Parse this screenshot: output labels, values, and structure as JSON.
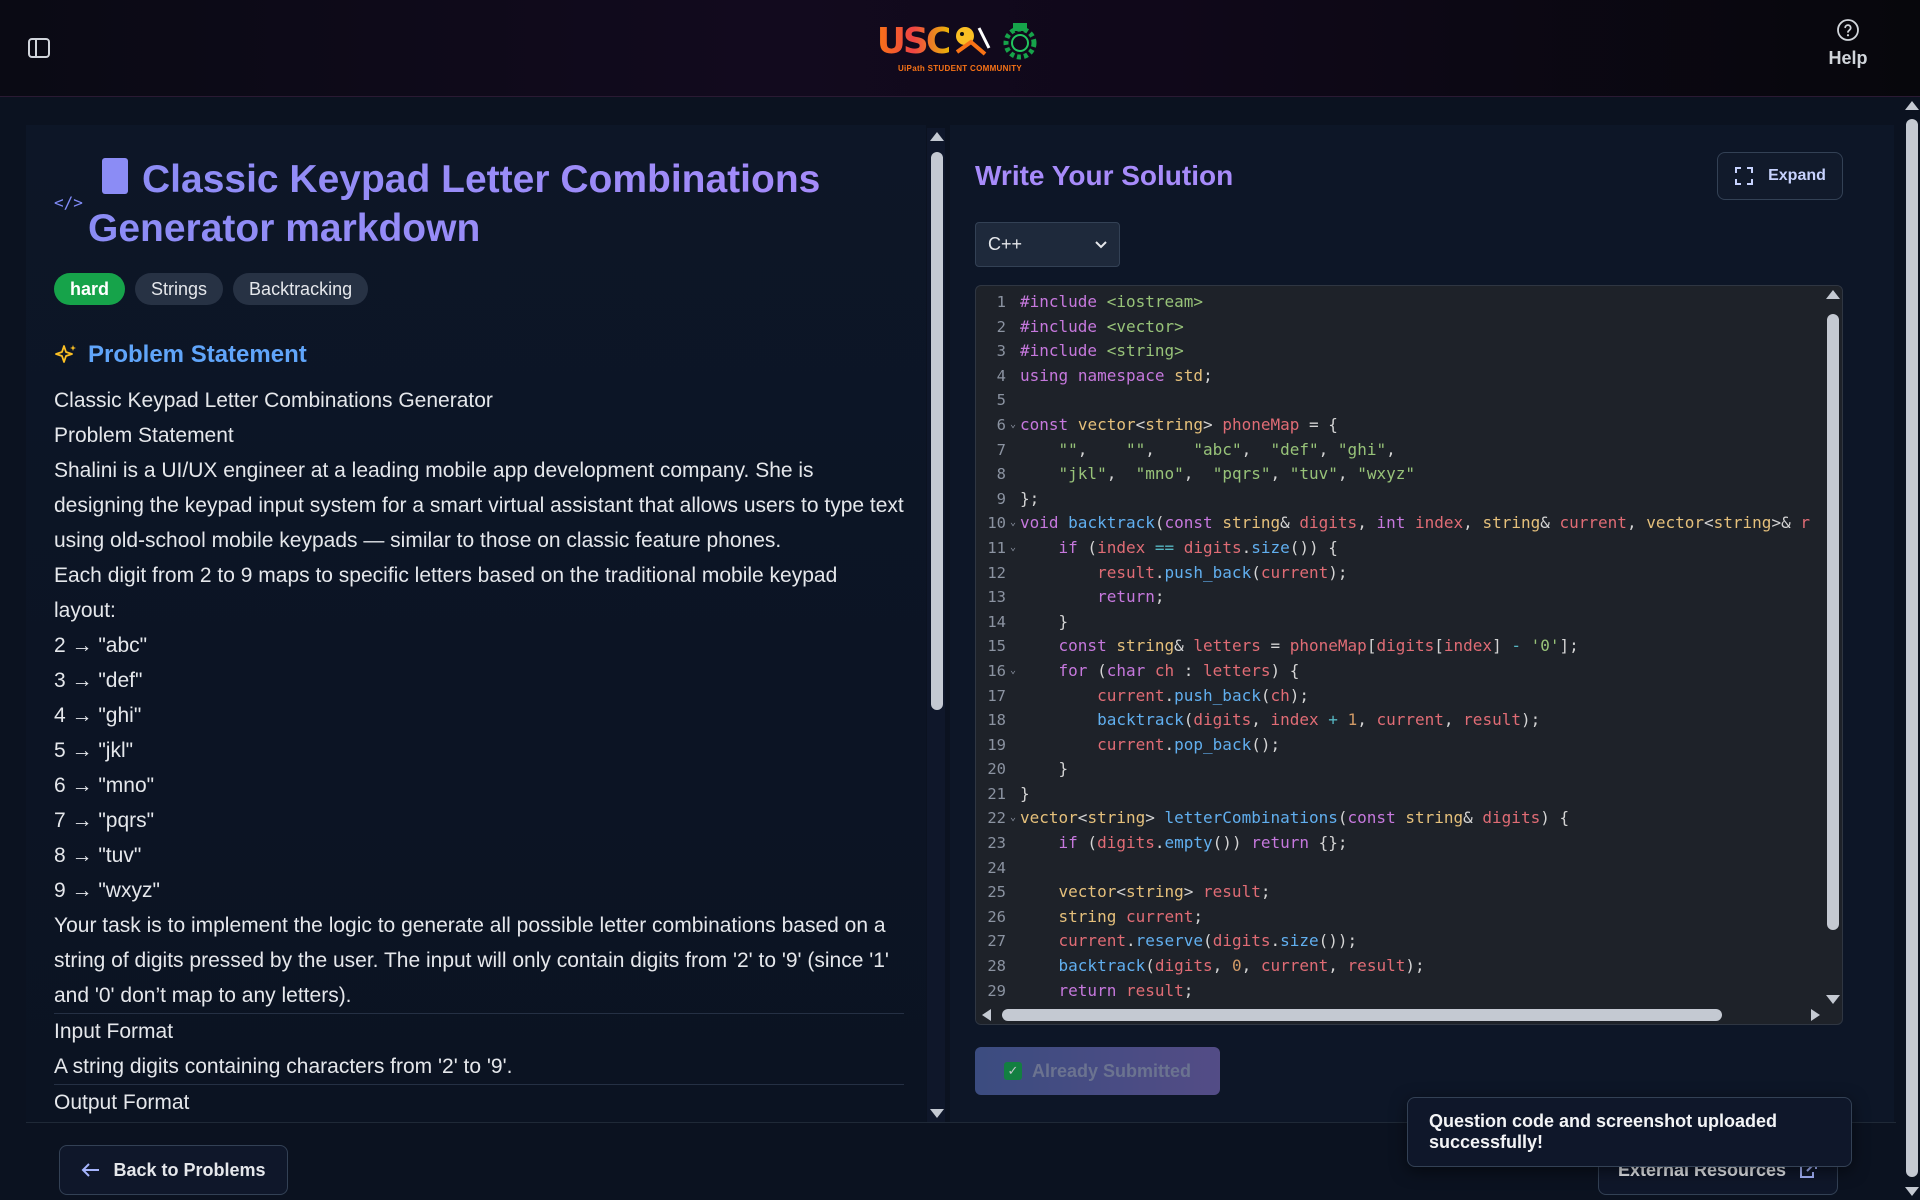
{
  "header": {
    "logo_text": "USC",
    "logo_subtitle": "UiPath STUDENT COMMUNITY",
    "help_label": "Help"
  },
  "problem": {
    "title": "Classic Keypad Letter Combinations Generator markdown",
    "tags": [
      "hard",
      "Strings",
      "Backtracking"
    ],
    "section_title": "Problem Statement",
    "statement": [
      "Classic Keypad Letter Combinations Generator",
      "Problem Statement",
      "Shalini is a UI/UX engineer at a leading mobile app development company. She is designing the keypad input system for a smart virtual assistant that allows users to type text using old-school mobile keypads — similar to those on classic feature phones.",
      "Each digit from 2 to 9 maps to specific letters based on the traditional mobile keypad layout:",
      "2 → \"abc\"",
      "3 → \"def\"",
      "4 → \"ghi\"",
      "5 → \"jkl\"",
      "6 → \"mno\"",
      "7 → \"pqrs\"",
      "8 → \"tuv\"",
      "9 → \"wxyz\"",
      "Your task is to implement the logic to generate all possible letter combinations based on a string of digits pressed by the user. The input will only contain digits from '2' to '9' (since '1' and '0' don’t map to any letters).",
      "Input Format",
      "A string digits containing characters from '2' to '9'.",
      "Output Format"
    ]
  },
  "editor": {
    "title": "Write Your Solution",
    "expand_label": "Expand",
    "language": "C++",
    "submit_label": "Already Submitted",
    "code_lines": [
      "#include <iostream>",
      "#include <vector>",
      "#include <string>",
      "using namespace std;",
      "",
      "const vector<string> phoneMap = {",
      "    \"\",    \"\",    \"abc\",  \"def\", \"ghi\",",
      "    \"jkl\",  \"mno\",  \"pqrs\", \"tuv\", \"wxyz\"",
      "};",
      "void backtrack(const string& digits, int index, string& current, vector<string>& r",
      "    if (index == digits.size()) {",
      "        result.push_back(current);",
      "        return;",
      "    }",
      "    const string& letters = phoneMap[digits[index] - '0'];",
      "    for (char ch : letters) {",
      "        current.push_back(ch);",
      "        backtrack(digits, index + 1, current, result);",
      "        current.pop_back();",
      "    }",
      "}",
      "vector<string> letterCombinations(const string& digits) {",
      "    if (digits.empty()) return {};",
      "",
      "    vector<string> result;",
      "    string current;",
      "    current.reserve(digits.size());",
      "    backtrack(digits, 0, current, result);",
      "    return result;"
    ],
    "fold_lines": [
      6,
      10,
      11,
      16,
      22
    ]
  },
  "footer": {
    "back_label": "Back to Problems",
    "external_label": "External Resources"
  },
  "toast": {
    "message": "Question code and screenshot uploaded successfully!"
  },
  "colors": {
    "accent": "#a78bfa",
    "hard_tag": "#16a34a",
    "section": "#60a5fa"
  }
}
